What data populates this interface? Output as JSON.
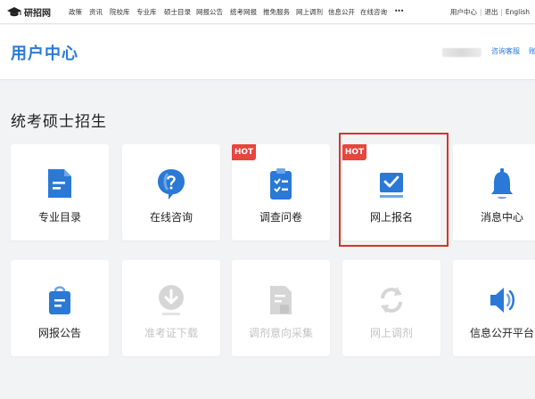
{
  "site": {
    "logo_text": "研招网"
  },
  "topnav": {
    "items": [
      "政策",
      "资讯",
      "院校库",
      "专业库",
      "硕士目录",
      "网报公告",
      "统考网报",
      "推免服务",
      "网上调剂",
      "信息公开",
      "在线咨询",
      "•••"
    ],
    "user_center": "用户中心",
    "logout": "退出",
    "english": "English"
  },
  "header": {
    "title": "用户中心",
    "feedback_link": "咨询客服",
    "account_link": "账"
  },
  "section": {
    "title": "统考硕士招生"
  },
  "cards": [
    {
      "label": "专业目录",
      "icon": "document-icon",
      "hot": "",
      "disabled": false
    },
    {
      "label": "在线咨询",
      "icon": "chat-question-icon",
      "hot": "",
      "disabled": false
    },
    {
      "label": "调查问卷",
      "icon": "clipboard-icon",
      "hot": "HOT",
      "disabled": false
    },
    {
      "label": "网上报名",
      "icon": "checkbox-icon",
      "hot": "HOT",
      "disabled": false
    },
    {
      "label": "消息中心",
      "icon": "bell-icon",
      "hot": "",
      "disabled": false
    },
    {
      "label": "网报公告",
      "icon": "notice-bag-icon",
      "hot": "",
      "disabled": false
    },
    {
      "label": "准考证下载",
      "icon": "download-icon",
      "hot": "",
      "disabled": true
    },
    {
      "label": "调剂意向采集",
      "icon": "form-icon",
      "hot": "",
      "disabled": true
    },
    {
      "label": "网上调剂",
      "icon": "refresh-icon",
      "hot": "",
      "disabled": true
    },
    {
      "label": "信息公开平台",
      "icon": "speaker-icon",
      "hot": "",
      "disabled": false
    }
  ],
  "colors": {
    "accent": "#2a79d6",
    "hot": "#e8453c",
    "highlight": "#d9322b",
    "disabled_icon": "#d6d6d6"
  }
}
